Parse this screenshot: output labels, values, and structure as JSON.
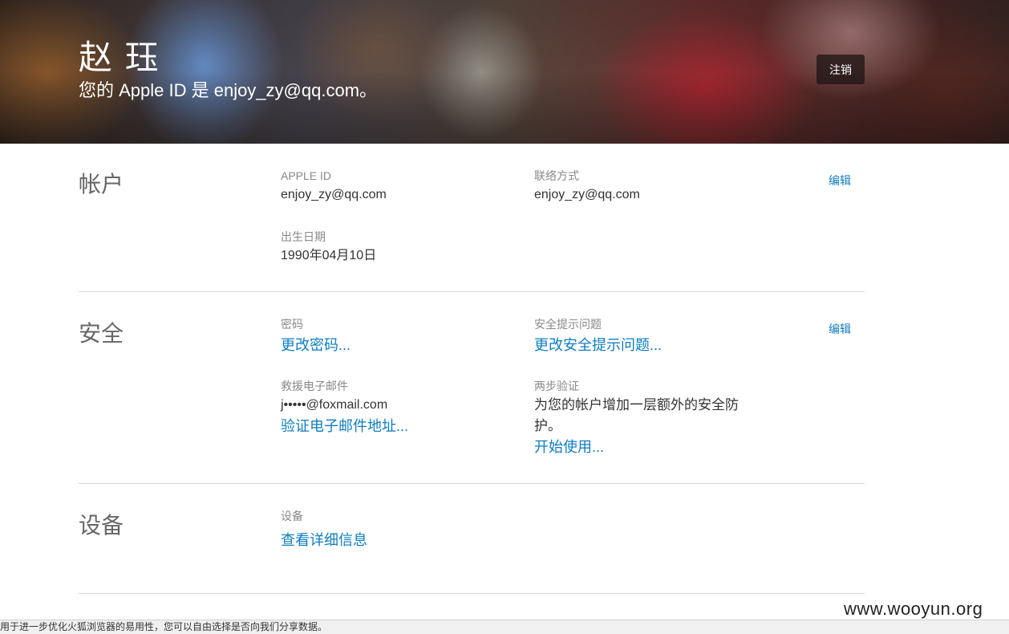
{
  "header": {
    "name": "赵 珏",
    "subtitle": "您的 Apple ID 是 enjoy_zy@qq.com。",
    "signout_label": "注销"
  },
  "account": {
    "title": "帐户",
    "edit_label": "编辑",
    "apple_id_label": "APPLE ID",
    "apple_id_value": "enjoy_zy@qq.com",
    "contact_label": "联络方式",
    "contact_value": "enjoy_zy@qq.com",
    "birthday_label": "出生日期",
    "birthday_value": "1990年04月10日"
  },
  "security": {
    "title": "安全",
    "edit_label": "编辑",
    "password_label": "密码",
    "password_link": "更改密码...",
    "questions_label": "安全提示问题",
    "questions_link": "更改安全提示问题...",
    "rescue_label": "救援电子邮件",
    "rescue_value": "j•••••@foxmail.com",
    "rescue_link": "验证电子邮件地址...",
    "twostep_label": "两步验证",
    "twostep_desc": "为您的帐户增加一层额外的安全防护。",
    "twostep_link": "开始使用..."
  },
  "devices": {
    "title": "设备",
    "label": "设备",
    "link": "查看详细信息"
  },
  "footer": {
    "notice": "用于进一步优化火狐浏览器的易用性，您可以自由选择是否向我们分享数据。",
    "watermark": "www.wooyun.org"
  }
}
